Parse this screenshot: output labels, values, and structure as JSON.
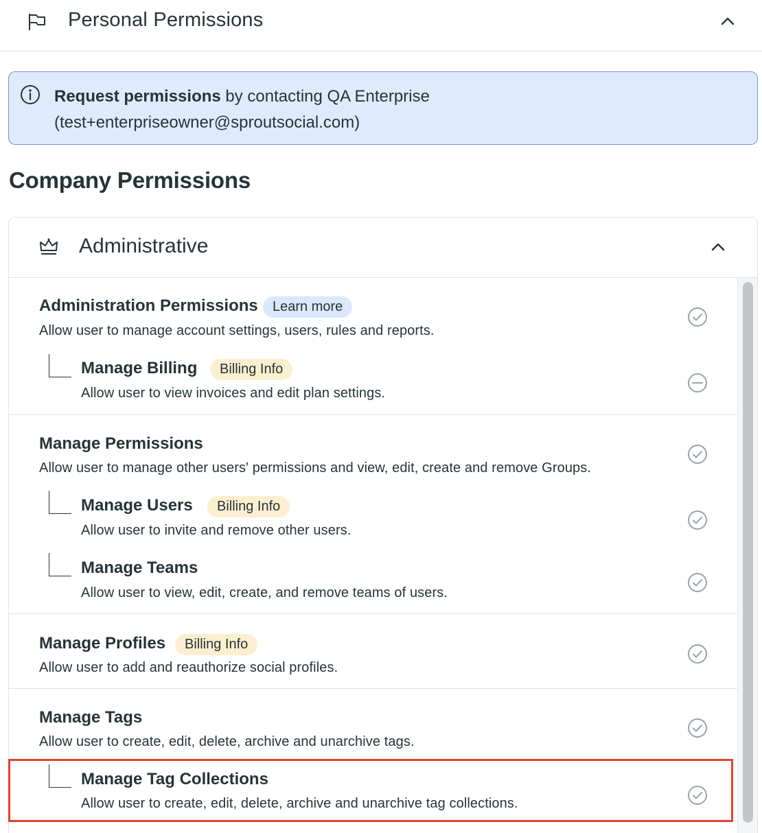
{
  "personal": {
    "title": "Personal Permissions"
  },
  "banner": {
    "bold": "Request permissions",
    "rest": " by contacting QA Enterprise",
    "email": "(test+enterpriseowner@sproutsocial.com)"
  },
  "company": {
    "title": "Company Permissions"
  },
  "admin": {
    "title": "Administrative",
    "perms": {
      "admin_permissions": {
        "name": "Administration Permissions",
        "badge": "Learn more",
        "desc": "Allow user to manage account settings, users, rules and reports.",
        "status": "granted"
      },
      "manage_billing": {
        "name": "Manage Billing",
        "badge": "Billing Info",
        "desc": "Allow user to view invoices and edit plan settings.",
        "status": "not-granted"
      },
      "manage_permissions": {
        "name": "Manage Permissions",
        "desc": "Allow user to manage other users' permissions and view, edit, create and remove Groups.",
        "status": "granted"
      },
      "manage_users": {
        "name": "Manage Users",
        "badge": "Billing Info",
        "desc": "Allow user to invite and remove other users.",
        "status": "granted"
      },
      "manage_teams": {
        "name": "Manage Teams",
        "desc": "Allow user to view, edit, create, and remove teams of users.",
        "status": "granted"
      },
      "manage_profiles": {
        "name": "Manage Profiles",
        "badge": "Billing Info",
        "desc": "Allow user to add and reauthorize social profiles.",
        "status": "granted"
      },
      "manage_tags": {
        "name": "Manage Tags",
        "desc": "Allow user to create, edit, delete, archive and unarchive tags.",
        "status": "granted"
      },
      "manage_tag_collections": {
        "name": "Manage Tag Collections",
        "desc": "Allow user to create, edit, delete, archive and unarchive tag collections.",
        "status": "granted"
      }
    }
  },
  "icons": {
    "flag": "flag-icon",
    "info": "info-icon",
    "crown": "crown-icon",
    "collapse": "chevron-up-icon",
    "granted": "check-circle-icon",
    "not_granted": "minus-circle-icon"
  },
  "colors": {
    "text": "#273338",
    "banner_bg": "#deebfc",
    "banner_border": "#6f95cf",
    "badge_blue": "#dbe7fb",
    "badge_yellow": "#fcefd0",
    "status_icon": "#9aa3a8",
    "highlight": "#e0432f"
  }
}
